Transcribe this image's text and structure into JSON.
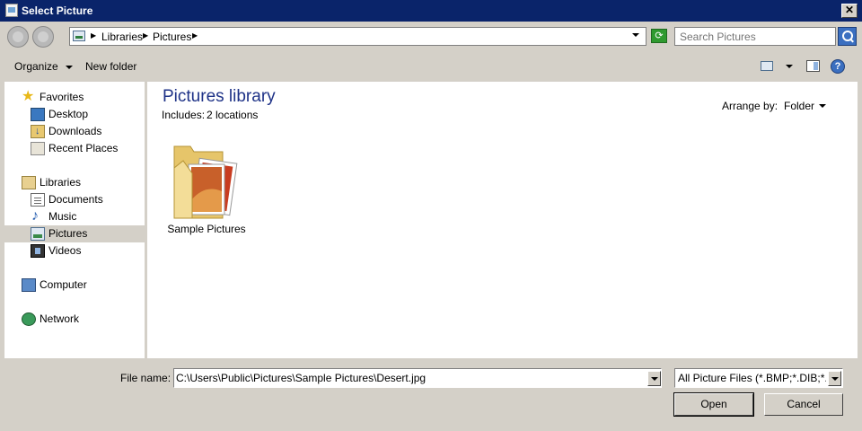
{
  "window": {
    "title": "Select Picture",
    "close_label": "✕"
  },
  "address": {
    "crumbs": [
      "Libraries",
      "Pictures"
    ]
  },
  "search": {
    "placeholder": "Search Pictures"
  },
  "toolbar": {
    "organize_label": "Organize",
    "new_folder_label": "New folder",
    "help_label": "?"
  },
  "nav": {
    "favorites": {
      "label": "Favorites",
      "items": [
        "Desktop",
        "Downloads",
        "Recent Places"
      ]
    },
    "libraries": {
      "label": "Libraries",
      "items": [
        "Documents",
        "Music",
        "Pictures",
        "Videos"
      ]
    },
    "computer": "Computer",
    "network": "Network",
    "selected": "Pictures"
  },
  "content": {
    "title": "Pictures library",
    "includes_label": "Includes:",
    "includes_value": "2 locations",
    "arrange_label": "Arrange by:",
    "arrange_value": "Folder",
    "items": [
      {
        "label": "Sample Pictures",
        "icon": "folder-icon"
      }
    ]
  },
  "bottom": {
    "filename_label": "File name:",
    "filename_value": "C:\\Users\\Public\\Pictures\\Sample Pictures\\Desert.jpg",
    "filetype_value": "All Picture Files (*.BMP;*.DIB;*.RLE;*.JPG;*.JPEG;*.JPE;*.JFIF;*.GIF;*.TIF;*.TIFF;*.PNG;*.ICO)",
    "open_label": "Open",
    "cancel_label": "Cancel"
  }
}
